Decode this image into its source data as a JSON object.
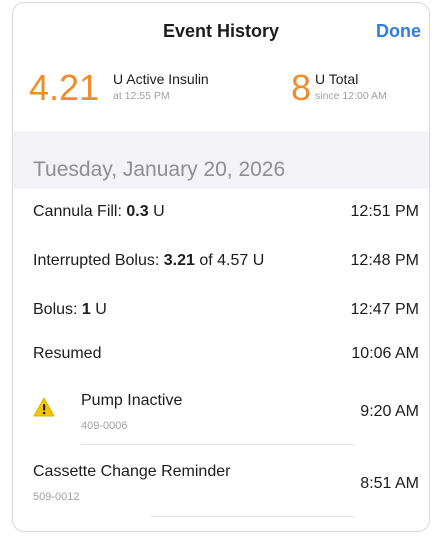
{
  "nav": {
    "title": "Event History",
    "done_label": "Done"
  },
  "summary": {
    "active": {
      "value": "4.21",
      "label": "U Active Insulin",
      "sub": "at 12:55 PM"
    },
    "total": {
      "value": "8",
      "label": "U Total",
      "sub": "since 12:00 AM"
    }
  },
  "date_header": "Tuesday, January 20, 2026",
  "events": [
    {
      "prefix": "Cannula Fill: ",
      "bold": "0.3",
      "suffix": " U",
      "time": "12:51 PM"
    },
    {
      "prefix": "Interrupted Bolus: ",
      "bold": "3.21",
      "suffix": " of 4.57 U",
      "time": "12:48 PM"
    },
    {
      "prefix": "Bolus: ",
      "bold": "1",
      "suffix": " U",
      "time": "12:47 PM"
    },
    {
      "prefix": "Resumed",
      "bold": "",
      "suffix": "",
      "time": "10:06 AM"
    },
    {
      "title": "Pump Inactive",
      "code": "409-0006",
      "time": "9:20 AM",
      "icon": "warning-icon"
    },
    {
      "title": "Cassette Change Reminder",
      "code": "509-0012",
      "time": "8:51 AM"
    }
  ],
  "colors": {
    "accent_orange": "#f28c28",
    "link_blue": "#2f7de1",
    "warning_yellow": "#f5c400",
    "secondary_text": "#a0a0a5",
    "section_bg": "#f2f2f7"
  }
}
